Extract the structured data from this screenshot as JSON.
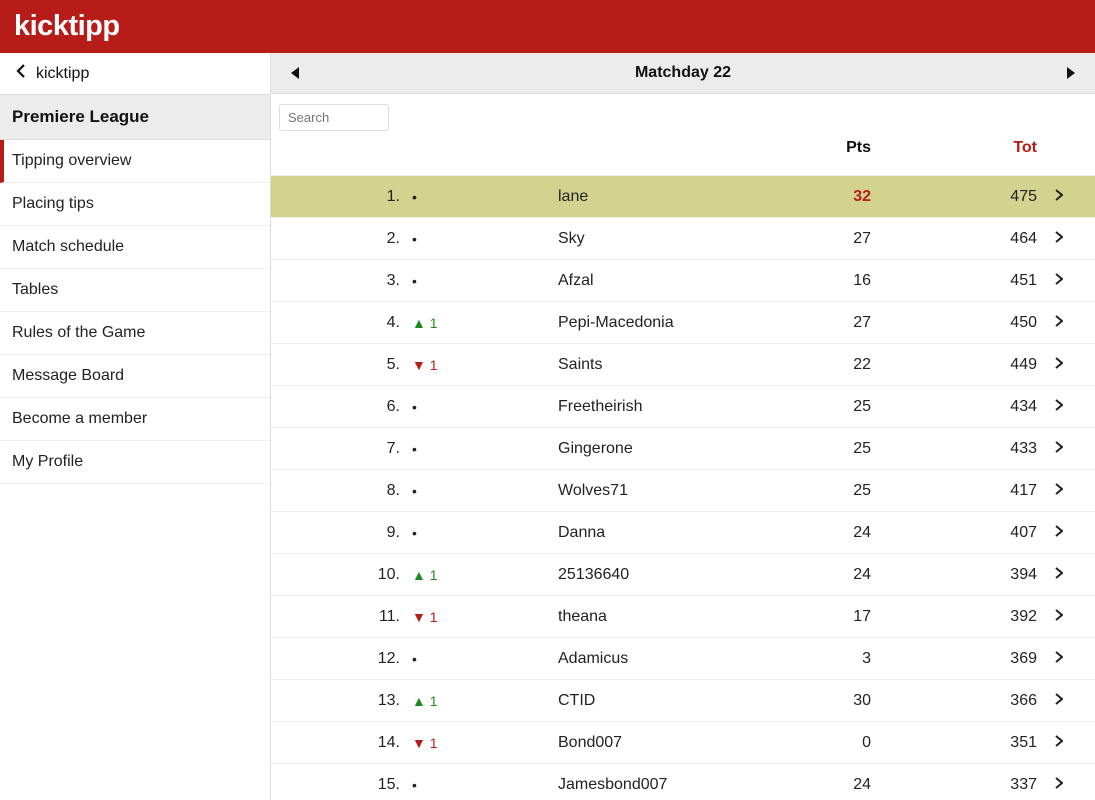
{
  "brand": "kicktipp",
  "breadcrumb": "kicktipp",
  "league_title": "Premiere League",
  "nav": [
    {
      "label": "Tipping overview",
      "active": true
    },
    {
      "label": "Placing tips"
    },
    {
      "label": "Match schedule"
    },
    {
      "label": "Tables"
    },
    {
      "label": "Rules of the Game"
    },
    {
      "label": "Message Board"
    },
    {
      "label": "Become a member"
    },
    {
      "label": "My Profile"
    }
  ],
  "matchday_label": "Matchday 22",
  "search_placeholder": "Search",
  "columns": {
    "pts": "Pts",
    "tot": "Tot"
  },
  "rows": [
    {
      "rank": "1.",
      "trend": "same",
      "trend_val": "",
      "name": "lane",
      "pts": "32",
      "tot": "475",
      "highlight": true
    },
    {
      "rank": "2.",
      "trend": "same",
      "trend_val": "",
      "name": "Sky",
      "pts": "27",
      "tot": "464"
    },
    {
      "rank": "3.",
      "trend": "same",
      "trend_val": "",
      "name": "Afzal",
      "pts": "16",
      "tot": "451"
    },
    {
      "rank": "4.",
      "trend": "up",
      "trend_val": "1",
      "name": "Pepi-Macedonia",
      "pts": "27",
      "tot": "450"
    },
    {
      "rank": "5.",
      "trend": "down",
      "trend_val": "1",
      "name": "Saints",
      "pts": "22",
      "tot": "449"
    },
    {
      "rank": "6.",
      "trend": "same",
      "trend_val": "",
      "name": "Freetheirish",
      "pts": "25",
      "tot": "434"
    },
    {
      "rank": "7.",
      "trend": "same",
      "trend_val": "",
      "name": "Gingerone",
      "pts": "25",
      "tot": "433"
    },
    {
      "rank": "8.",
      "trend": "same",
      "trend_val": "",
      "name": "Wolves71",
      "pts": "25",
      "tot": "417"
    },
    {
      "rank": "9.",
      "trend": "same",
      "trend_val": "",
      "name": "Danna",
      "pts": "24",
      "tot": "407"
    },
    {
      "rank": "10.",
      "trend": "up",
      "trend_val": "1",
      "name": "25136640",
      "pts": "24",
      "tot": "394"
    },
    {
      "rank": "11.",
      "trend": "down",
      "trend_val": "1",
      "name": "theana",
      "pts": "17",
      "tot": "392"
    },
    {
      "rank": "12.",
      "trend": "same",
      "trend_val": "",
      "name": "Adamicus",
      "pts": "3",
      "tot": "369"
    },
    {
      "rank": "13.",
      "trend": "up",
      "trend_val": "1",
      "name": "CTID",
      "pts": "30",
      "tot": "366"
    },
    {
      "rank": "14.",
      "trend": "down",
      "trend_val": "1",
      "name": "Bond007",
      "pts": "0",
      "tot": "351"
    },
    {
      "rank": "15.",
      "trend": "same",
      "trend_val": "",
      "name": "Jamesbond007",
      "pts": "24",
      "tot": "337"
    }
  ]
}
